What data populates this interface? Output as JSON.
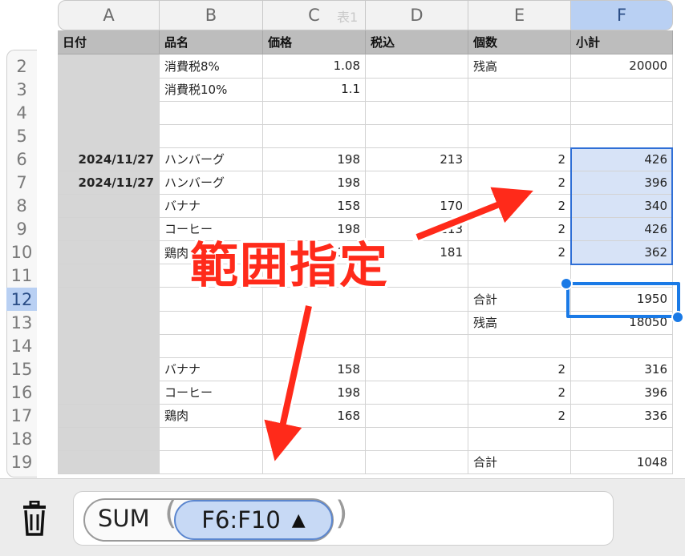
{
  "table_name": "表1",
  "columns": [
    "A",
    "B",
    "C",
    "D",
    "E",
    "F"
  ],
  "selected_column": "F",
  "row_numbers": [
    "2",
    "3",
    "4",
    "5",
    "6",
    "7",
    "8",
    "9",
    "10",
    "11",
    "12",
    "13",
    "14",
    "15",
    "16",
    "17",
    "18",
    "19"
  ],
  "selected_row": "12",
  "header_row": [
    "日付",
    "品名",
    "価格",
    "税込",
    "個数",
    "小計"
  ],
  "rows": [
    [
      "",
      "消費税8%",
      "1.08",
      "",
      "残高",
      "20000"
    ],
    [
      "",
      "消費税10%",
      "1.1",
      "",
      "",
      ""
    ],
    [
      "",
      "",
      "",
      "",
      "",
      ""
    ],
    [
      "",
      "",
      "",
      "",
      "",
      ""
    ],
    [
      "2024/11/27",
      "ハンバーグ",
      "198",
      "213",
      "2",
      "426"
    ],
    [
      "2024/11/27",
      "ハンバーグ",
      "198",
      "",
      "2",
      "396"
    ],
    [
      "",
      "バナナ",
      "158",
      "170",
      "2",
      "340"
    ],
    [
      "",
      "コーヒー",
      "198",
      "213",
      "2",
      "426"
    ],
    [
      "",
      "鶏肉",
      "168",
      "181",
      "2",
      "362"
    ],
    [
      "",
      "",
      "",
      "",
      "",
      ""
    ],
    [
      "",
      "",
      "",
      "",
      "合計",
      "1950"
    ],
    [
      "",
      "",
      "",
      "",
      "残高",
      "18050"
    ],
    [
      "",
      "",
      "",
      "",
      "",
      ""
    ],
    [
      "",
      "バナナ",
      "158",
      "",
      "2",
      "316"
    ],
    [
      "",
      "コーヒー",
      "198",
      "",
      "2",
      "396"
    ],
    [
      "",
      "鶏肉",
      "168",
      "",
      "2",
      "336"
    ],
    [
      "",
      "",
      "",
      "",
      "",
      ""
    ],
    [
      "",
      "",
      "",
      "",
      "合計",
      "1048"
    ]
  ],
  "annotation_text": "範囲指定",
  "formula": {
    "function": "SUM",
    "reference": "F6:F10",
    "reference_caret": "▲"
  },
  "icons": {
    "delete": "trash-icon"
  },
  "colors": {
    "selection": "#1a7ae6",
    "selection_fill": "#d7e3f7",
    "header_fill": "#bdbdbd",
    "column_a_fill": "#d6d6d6",
    "annotation": "#ff2a1a"
  }
}
